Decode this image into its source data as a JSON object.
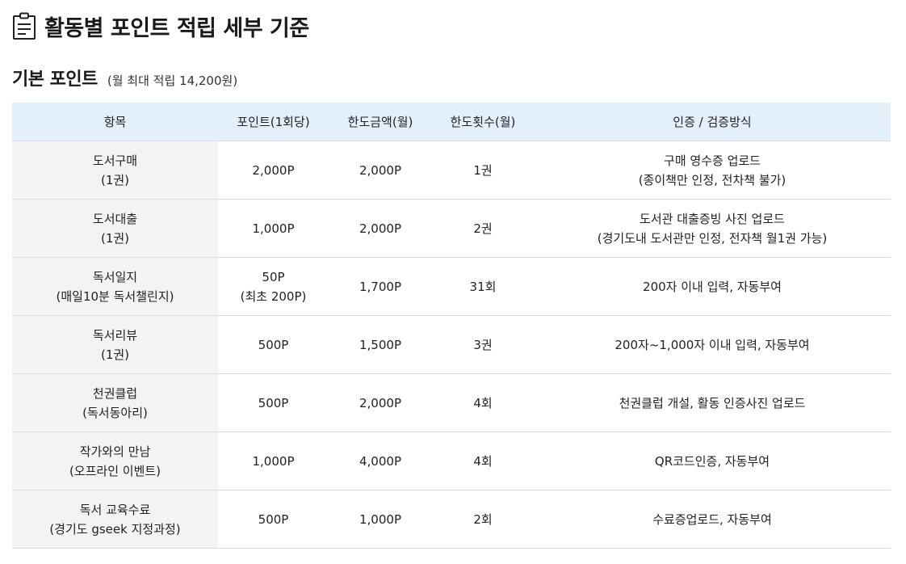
{
  "page": {
    "title": "활동별 포인트 적립 세부 기준",
    "title_icon": "clipboard-icon"
  },
  "section": {
    "title": "기본 포인트",
    "note": "(월 최대 적립 14,200원)"
  },
  "table": {
    "headers": [
      "항목",
      "포인트(1회당)",
      "한도금액(월)",
      "한도횟수(월)",
      "인증 / 검증방식"
    ],
    "rows": [
      {
        "item": [
          "도서구매",
          "(1권)"
        ],
        "points": [
          "2,000P"
        ],
        "limit_amount": "2,000P",
        "limit_count": "1권",
        "method": [
          "구매 영수증 업로드",
          "(종이책만 인정, 전차책 불가)"
        ]
      },
      {
        "item": [
          "도서대출",
          "(1권)"
        ],
        "points": [
          "1,000P"
        ],
        "limit_amount": "2,000P",
        "limit_count": "2권",
        "method": [
          "도서관 대출증빙 사진 업로드",
          "(경기도내 도서관만 인정, 전자책 월1권 가능)"
        ]
      },
      {
        "item": [
          "독서일지",
          "(매일10분 독서챌린지)"
        ],
        "points": [
          "50P",
          "(최초 200P)"
        ],
        "limit_amount": "1,700P",
        "limit_count": "31회",
        "method": [
          "200자 이내 입력, 자동부여"
        ]
      },
      {
        "item": [
          "독서리뷰",
          "(1권)"
        ],
        "points": [
          "500P"
        ],
        "limit_amount": "1,500P",
        "limit_count": "3권",
        "method": [
          "200자~1,000자 이내 입력, 자동부여"
        ]
      },
      {
        "item": [
          "천권클럽",
          "(독서동아리)"
        ],
        "points": [
          "500P"
        ],
        "limit_amount": "2,000P",
        "limit_count": "4회",
        "method": [
          "천권클럽 개설, 활동 인증사진 업로드"
        ]
      },
      {
        "item": [
          "작가와의 만남",
          "(오프라인 이벤트)"
        ],
        "points": [
          "1,000P"
        ],
        "limit_amount": "4,000P",
        "limit_count": "4회",
        "method": [
          "QR코드인증, 자동부여"
        ]
      },
      {
        "item": [
          "독서 교육수료",
          "(경기도 gseek 지정과정)"
        ],
        "points": [
          "500P"
        ],
        "limit_amount": "1,000P",
        "limit_count": "2회",
        "method": [
          "수료증업로드, 자동부여"
        ]
      }
    ]
  }
}
